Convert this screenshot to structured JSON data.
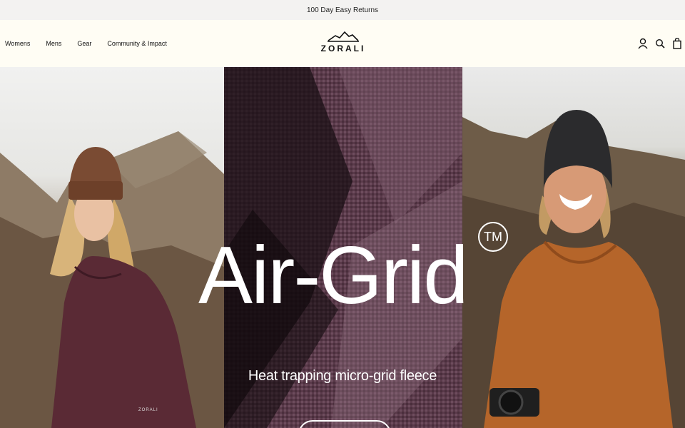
{
  "announcement": "100 Day Easy Returns",
  "nav": {
    "items": [
      "Womens",
      "Mens",
      "Gear",
      "Community & Impact"
    ]
  },
  "brand": {
    "wordmark": "ZORALI"
  },
  "header_icons": [
    "account-icon",
    "search-icon",
    "cart-icon"
  ],
  "hero": {
    "headline": "Air-Grid",
    "trademark": "TM",
    "subheadline": "Heat trapping micro-grid fleece",
    "sweater_label": "ZORALI"
  },
  "colors": {
    "announcement_bg": "#f3f2f1",
    "header_bg": "#fffdf4",
    "fabric_purple": "#4a2e3c",
    "womens_hoodie": "#5a2a35",
    "mens_hoodie": "#b5652a"
  }
}
